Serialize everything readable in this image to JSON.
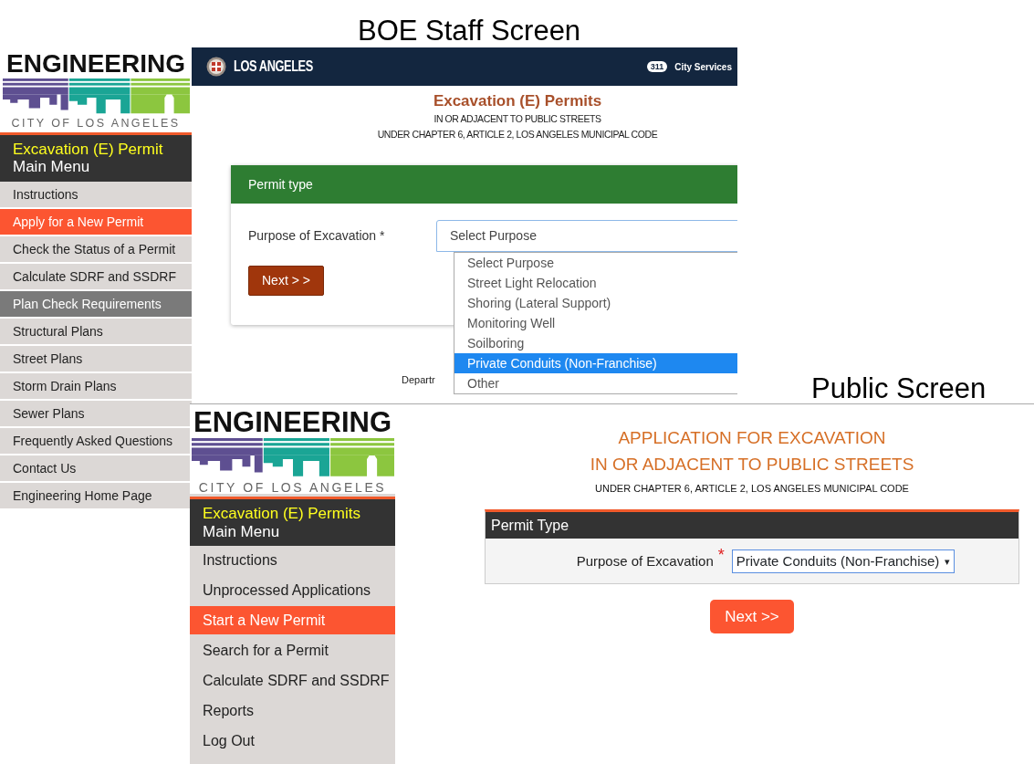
{
  "staff_screen": {
    "caption": "BOE Staff Screen",
    "sidebar": {
      "logo": {
        "wordmark": "ENGINEERING",
        "city": "CITY OF LOS ANGELES"
      },
      "heading": "Excavation (E) Permit",
      "subheading": "Main Menu",
      "items": [
        {
          "label": "Instructions",
          "kind": "link",
          "selected": false
        },
        {
          "label": "Apply for a New Permit",
          "kind": "link",
          "selected": true
        },
        {
          "label": "Check the Status of a Permit",
          "kind": "link",
          "selected": false
        },
        {
          "label": "Calculate SDRF and SSDRF",
          "kind": "link",
          "selected": false
        },
        {
          "label": "Plan Check Requirements",
          "kind": "section",
          "selected": false
        },
        {
          "label": "Structural Plans",
          "kind": "link",
          "selected": false
        },
        {
          "label": "Street Plans",
          "kind": "link",
          "selected": false
        },
        {
          "label": "Storm Drain Plans",
          "kind": "link",
          "selected": false
        },
        {
          "label": "Sewer Plans",
          "kind": "link",
          "selected": false
        },
        {
          "label": "Frequently Asked Questions",
          "kind": "link",
          "selected": false
        },
        {
          "label": "Contact Us",
          "kind": "link",
          "selected": false
        },
        {
          "label": "Engineering Home Page",
          "kind": "link",
          "selected": false
        }
      ]
    },
    "header": {
      "brand": "LOS ANGELES",
      "badge": "311",
      "link": "City Services"
    },
    "title": "Excavation (E) Permits",
    "subtitle_lines": [
      "IN OR ADJACENT TO PUBLIC STREETS",
      "UNDER CHAPTER 6, ARTICLE 2, LOS ANGELES MUNICIPAL CODE"
    ],
    "form": {
      "header": "Permit type",
      "label": "Purpose of Excavation *",
      "select_value": "Select Purpose",
      "expanded": true,
      "options": [
        {
          "label": "Select Purpose",
          "selected": false
        },
        {
          "label": "Street Light Relocation",
          "selected": false
        },
        {
          "label": "Shoring (Lateral Support)",
          "selected": false
        },
        {
          "label": "Monitoring Well",
          "selected": false
        },
        {
          "label": "Soilboring",
          "selected": false
        },
        {
          "label": "Private Conduits (Non-Franchise)",
          "selected": true
        },
        {
          "label": "Other",
          "selected": false
        }
      ],
      "button": "Next > >"
    },
    "footer_fragment": "Departr"
  },
  "public_screen": {
    "caption": "Public Screen",
    "sidebar": {
      "logo": {
        "wordmark": "ENGINEERING",
        "city": "CITY OF LOS ANGELES"
      },
      "heading": "Excavation (E) Permits",
      "subheading": "Main Menu",
      "items": [
        {
          "label": "Instructions",
          "kind": "link",
          "selected": false
        },
        {
          "label": "Unprocessed Applications",
          "kind": "link",
          "selected": false
        },
        {
          "label": "Start a New Permit",
          "kind": "link",
          "selected": true
        },
        {
          "label": "Search for a Permit",
          "kind": "link",
          "selected": false
        },
        {
          "label": "Calculate SDRF and SSDRF",
          "kind": "link",
          "selected": false
        },
        {
          "label": "Reports",
          "kind": "link",
          "selected": false
        },
        {
          "label": "Log Out",
          "kind": "link",
          "selected": false
        }
      ]
    },
    "title_lines": [
      "APPLICATION FOR EXCAVATION",
      "IN OR ADJACENT TO PUBLIC STREETS"
    ],
    "subtitle": "UNDER CHAPTER 6, ARTICLE 2, LOS ANGELES MUNICIPAL CODE",
    "form": {
      "header": "Permit Type",
      "label": "Purpose of Excavation",
      "required_mark": "*",
      "select_value": "Private Conduits (Non-Franchise)",
      "caret": "▾",
      "button": "Next >>"
    }
  }
}
